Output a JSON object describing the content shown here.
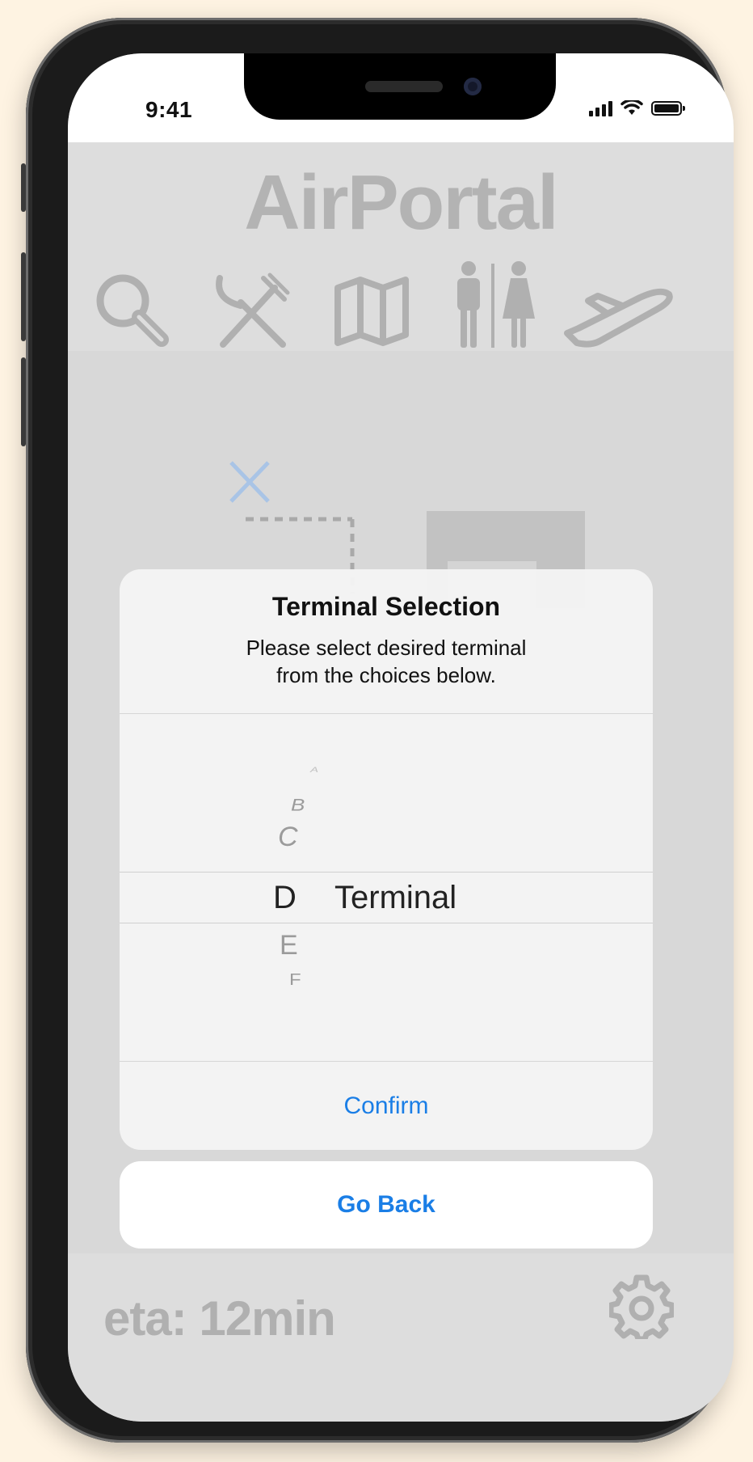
{
  "status_bar": {
    "time": "9:41"
  },
  "app": {
    "logo": "AirPortal"
  },
  "nav_icons": [
    "search-icon",
    "restaurant-icon",
    "map-icon",
    "restroom-icon",
    "flight-icon"
  ],
  "footer": {
    "eta": "eta: 12min"
  },
  "dialog": {
    "title": "Terminal Selection",
    "message_line1": "Please select desired terminal",
    "message_line2": "from the choices below.",
    "picker": {
      "items": [
        "A",
        "B",
        "C",
        "D",
        "E",
        "F"
      ],
      "selected": "D",
      "suffix": "Terminal"
    },
    "confirm_label": "Confirm"
  },
  "go_back_label": "Go Back",
  "colors": {
    "accent": "#1a7ee6",
    "background": "#fef3e2"
  }
}
